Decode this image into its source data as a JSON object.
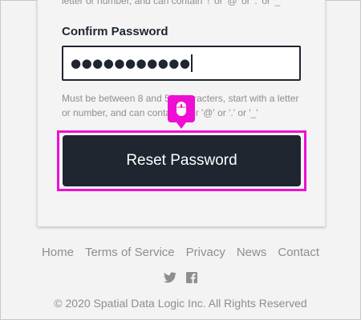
{
  "form": {
    "hint_top": "letter or number, and can contain '!' or '@' or '.' or '_'",
    "confirm_label": "Confirm Password",
    "confirm_value": "●●●●●●●●●●●",
    "hint_bottom": "Must be between 8 and 50 characters, start with a letter or number, and can contain '!' or '@' or '.' or '_'",
    "reset_button": "Reset Password"
  },
  "footer": {
    "links": [
      "Home",
      "Terms of Service",
      "Privacy",
      "News",
      "Contact"
    ],
    "social": [
      "twitter-icon",
      "facebook-icon"
    ],
    "copyright": "© 2020 Spatial Data Logic Inc. All Rights Reserved"
  },
  "colors": {
    "button_bg": "#1f2630",
    "highlight": "#ee0fd2",
    "muted_text": "#8e8e8e"
  }
}
